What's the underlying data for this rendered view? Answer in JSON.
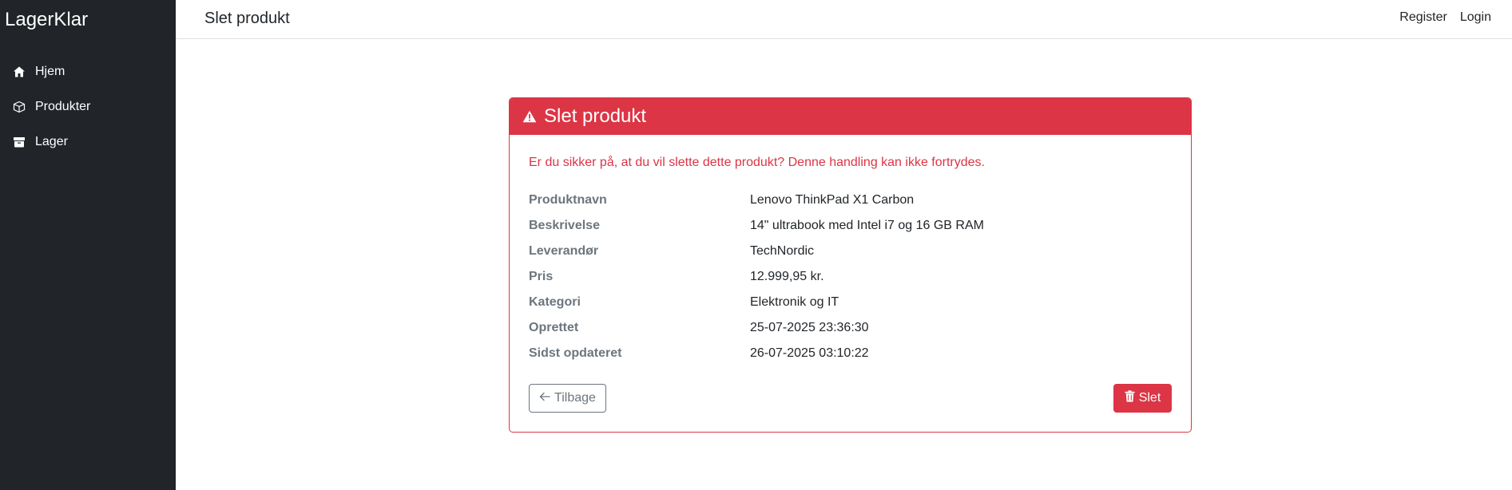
{
  "app": {
    "brand": "LagerKlar"
  },
  "sidebar": {
    "items": [
      {
        "label": "Hjem",
        "icon": "home-icon"
      },
      {
        "label": "Produkter",
        "icon": "box-icon"
      },
      {
        "label": "Lager",
        "icon": "archive-icon"
      }
    ]
  },
  "header": {
    "title": "Slet produkt",
    "links": {
      "register": "Register",
      "login": "Login"
    }
  },
  "card": {
    "title": "Slet produkt",
    "warning": "Er du sikker på, at du vil slette dette produkt? Denne handling kan ikke fortrydes.",
    "details": [
      {
        "label": "Produktnavn",
        "value": "Lenovo ThinkPad X1 Carbon"
      },
      {
        "label": "Beskrivelse",
        "value": "14\" ultrabook med Intel i7 og 16 GB RAM"
      },
      {
        "label": "Leverandør",
        "value": "TechNordic"
      },
      {
        "label": "Pris",
        "value": "12.999,95 kr."
      },
      {
        "label": "Kategori",
        "value": "Elektronik og IT"
      },
      {
        "label": "Oprettet",
        "value": "25-07-2025 23:36:30"
      },
      {
        "label": "Sidst opdateret",
        "value": "26-07-2025 03:10:22"
      }
    ],
    "back_label": "Tilbage",
    "delete_label": "Slet"
  },
  "colors": {
    "danger": "#dc3545",
    "sidebar": "#212529",
    "muted": "#6c757d"
  }
}
